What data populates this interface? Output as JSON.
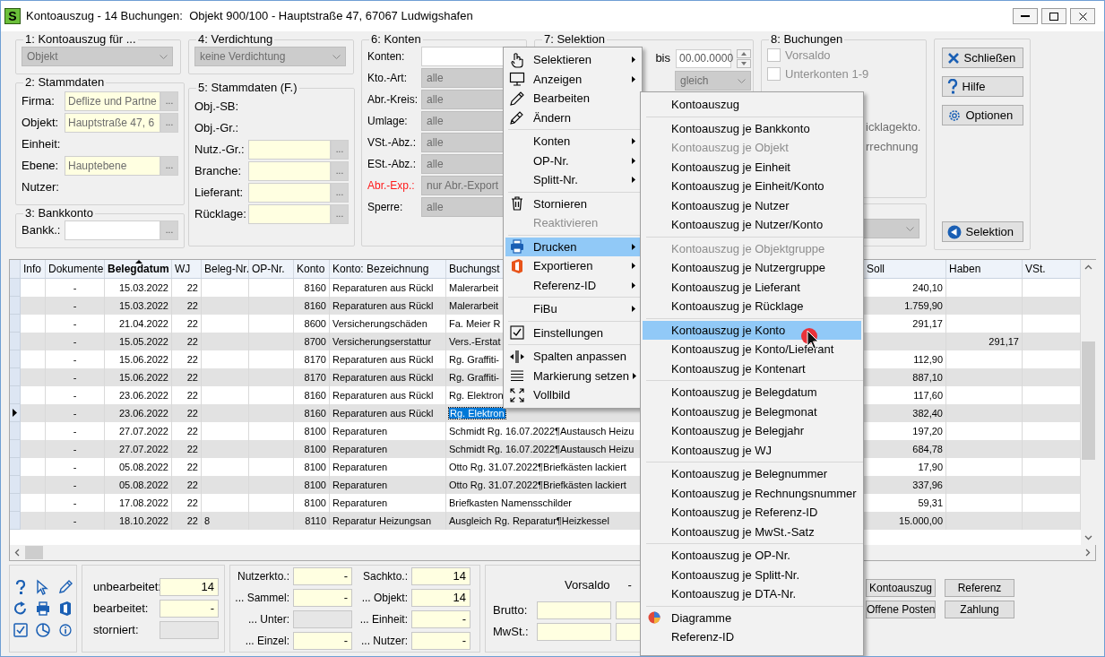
{
  "window": {
    "icon_letter": "S",
    "title": "Kontoauszug - 14 Buchungen:  Objekt 900/100 - Hauptstraße 47, 67067 Ludwigshafen"
  },
  "kontoauszug_fuer": {
    "title": "1: Kontoauszug für ...",
    "value": "Objekt"
  },
  "stammdaten": {
    "title": "2: Stammdaten",
    "rows": [
      {
        "label": "Firma:",
        "kind": "lookup",
        "value": "Deflize und Partne",
        "button": "..."
      },
      {
        "label": "Objekt:",
        "kind": "lookup",
        "value": "Hauptstraße 47, 6",
        "button": "..."
      },
      {
        "label": "Einheit:",
        "kind": "label"
      },
      {
        "label": "Ebene:",
        "kind": "lookup",
        "value": "Hauptebene",
        "button": "..."
      },
      {
        "label": "Nutzer:",
        "kind": "label"
      }
    ]
  },
  "bankkonto": {
    "title": "3: Bankkonto",
    "rows": [
      {
        "label": "Bankk.:",
        "kind": "input",
        "button": "..."
      }
    ]
  },
  "verdichtung": {
    "title": "4: Verdichtung",
    "value": "keine Verdichtung"
  },
  "stammdaten_f": {
    "title": "5: Stammdaten (F.)",
    "rows": [
      {
        "label": "Obj.-SB:",
        "kind": "label"
      },
      {
        "label": "Obj.-Gr.:",
        "kind": "label"
      },
      {
        "label": "Nutz.-Gr.:",
        "kind": "lookup",
        "button": "..."
      },
      {
        "label": "Branche:",
        "kind": "lookup",
        "button": "..."
      },
      {
        "label": "Lieferant:",
        "kind": "lookup",
        "button": "..."
      },
      {
        "label": "Rücklage:",
        "kind": "lookup",
        "button": "..."
      }
    ]
  },
  "konten": {
    "title": "6: Konten",
    "rows": [
      {
        "label": "Konten:",
        "kind": "input",
        "alert": false
      },
      {
        "label": "Kto.-Art:",
        "kind": "select",
        "value": "alle",
        "alert": false
      },
      {
        "label": "Abr.-Kreis:",
        "kind": "select",
        "value": "alle",
        "alert": false
      },
      {
        "label": "Umlage:",
        "kind": "select",
        "value": "alle",
        "alert": false
      },
      {
        "label": "VSt.-Abz.:",
        "kind": "select",
        "value": "alle",
        "alert": false
      },
      {
        "label": "ESt.-Abz.:",
        "kind": "select",
        "value": "alle",
        "alert": false
      },
      {
        "label": "Abr.-Exp.:",
        "kind": "select",
        "value": "nur Abr.-Export",
        "alert": true
      },
      {
        "label": "Sperre:",
        "kind": "select",
        "value": "alle",
        "alert": false
      }
    ]
  },
  "selektion": {
    "title": "7: Selektion",
    "to_label": "bis",
    "to_date": "00.00.0000",
    "mode": "gleich"
  },
  "buchungen": {
    "title": "8: Buchungen",
    "options": [
      {
        "label": "Vorsaldo",
        "checked": false,
        "disabled": true
      },
      {
        "label": "Unterkonten 1-9",
        "checked": false,
        "disabled": true
      }
    ],
    "partial_labels": [
      "icklagekto.",
      "rrechnung"
    ]
  },
  "actions": [
    {
      "label": "Schließen"
    },
    {
      "label": "Hilfe"
    },
    {
      "label": "Optionen"
    },
    {
      "label": "Selektion"
    }
  ],
  "table": {
    "columns": [
      {
        "label": "Info",
        "sorted": false
      },
      {
        "label": "Dokumente",
        "sorted": false
      },
      {
        "label": "Belegdatum",
        "sorted": true
      },
      {
        "label": "WJ",
        "sorted": false
      },
      {
        "label": "Beleg-Nr.",
        "sorted": false
      },
      {
        "label": "OP-Nr.",
        "sorted": false
      },
      {
        "label": "Konto",
        "sorted": false
      },
      {
        "label": "Konto: Bezeichnung",
        "sorted": false
      },
      {
        "label": "Buchungst",
        "sorted": false
      },
      {
        "label": "Soll",
        "sorted": false
      },
      {
        "label": "Haben",
        "sorted": false
      },
      {
        "label": "VSt.",
        "sorted": false
      }
    ],
    "rows": [
      {
        "selected": false,
        "dokumente": "-",
        "belegdatum": "15.03.2022",
        "wj": "22",
        "konto": "8160",
        "bezeichnung": "Reparaturen aus Rückl",
        "buchungstext": "Malerarbeit",
        "soll": "240,10"
      },
      {
        "selected": false,
        "dokumente": "-",
        "belegdatum": "15.03.2022",
        "wj": "22",
        "konto": "8160",
        "bezeichnung": "Reparaturen aus Rückl",
        "buchungstext": "Malerarbeit",
        "soll": "1.759,90"
      },
      {
        "selected": false,
        "dokumente": "-",
        "belegdatum": "21.04.2022",
        "wj": "22",
        "konto": "8600",
        "bezeichnung": "Versicherungschäden",
        "buchungstext": "Fa. Meier R",
        "soll": "291,17"
      },
      {
        "selected": false,
        "dokumente": "-",
        "belegdatum": "15.05.2022",
        "wj": "22",
        "konto": "8700",
        "bezeichnung": "Versicherungserstattur",
        "buchungstext": "Vers.-Erstat",
        "haben": "291,17"
      },
      {
        "selected": false,
        "dokumente": "-",
        "belegdatum": "15.06.2022",
        "wj": "22",
        "konto": "8170",
        "bezeichnung": "Reparaturen aus Rückl",
        "buchungstext": "Rg. Graffiti-",
        "soll": "112,90"
      },
      {
        "selected": false,
        "dokumente": "-",
        "belegdatum": "15.06.2022",
        "wj": "22",
        "konto": "8170",
        "bezeichnung": "Reparaturen aus Rückl",
        "buchungstext": "Rg. Graffiti-",
        "soll": "887,10"
      },
      {
        "selected": false,
        "dokumente": "-",
        "belegdatum": "23.06.2022",
        "wj": "22",
        "konto": "8160",
        "bezeichnung": "Reparaturen aus Rückl",
        "buchungstext": "Rg. Elektron",
        "soll": "117,60"
      },
      {
        "selected": true,
        "dokumente": "-",
        "belegdatum": "23.06.2022",
        "wj": "22",
        "konto": "8160",
        "bezeichnung": "Reparaturen aus Rückl",
        "buchungstext": "Rg. Elektron",
        "soll": "382,40"
      },
      {
        "selected": false,
        "dokumente": "-",
        "belegdatum": "27.07.2022",
        "wj": "22",
        "konto": "8100",
        "bezeichnung": "Reparaturen",
        "buchungstext": "Schmidt Rg. 16.07.2022¶Austausch Heizu",
        "soll": "197,20"
      },
      {
        "selected": false,
        "dokumente": "-",
        "belegdatum": "27.07.2022",
        "wj": "22",
        "konto": "8100",
        "bezeichnung": "Reparaturen",
        "buchungstext": "Schmidt Rg. 16.07.2022¶Austausch Heizu",
        "soll": "684,78"
      },
      {
        "selected": false,
        "dokumente": "-",
        "belegdatum": "05.08.2022",
        "wj": "22",
        "konto": "8100",
        "bezeichnung": "Reparaturen",
        "buchungstext": "Otto Rg. 31.07.2022¶Briefkästen lackiert",
        "soll": "17,90"
      },
      {
        "selected": false,
        "dokumente": "-",
        "belegdatum": "05.08.2022",
        "wj": "22",
        "konto": "8100",
        "bezeichnung": "Reparaturen",
        "buchungstext": "Otto Rg. 31.07.2022¶Briefkästen lackiert",
        "soll": "337,96"
      },
      {
        "selected": false,
        "dokumente": "-",
        "belegdatum": "17.08.2022",
        "wj": "22",
        "konto": "8100",
        "bezeichnung": "Reparaturen",
        "buchungstext": "Briefkasten Namensschilder",
        "soll": "59,31"
      },
      {
        "selected": false,
        "dokumente": "-",
        "belegdatum": "18.10.2022",
        "wj": "22",
        "beleg_nr": "8",
        "konto": "8110",
        "bezeichnung": "Reparatur Heizungsan",
        "buchungstext": "Ausgleich Rg. Reparatur¶Heizkessel",
        "soll": "15.000,00"
      }
    ]
  },
  "status_counts": [
    {
      "label": "unbearbeitet:",
      "value": "14",
      "disabled": false
    },
    {
      "label": "bearbeitet:",
      "value": "-",
      "disabled": false
    },
    {
      "label": "storniert:",
      "disabled": true
    }
  ],
  "nutzer_counts": [
    {
      "label": "Nutzerkto.:",
      "value": "-",
      "disabled": false
    },
    {
      "label": "... Sammel:",
      "value": "-",
      "disabled": false
    },
    {
      "label": "... Unter:",
      "disabled": true
    },
    {
      "label": "... Einzel:",
      "value": "-",
      "disabled": false
    }
  ],
  "sach_counts": [
    {
      "label": "Sachkto.:",
      "value": "14"
    },
    {
      "label": "... Objekt:",
      "value": "14"
    },
    {
      "label": "... Einheit:",
      "value": "-"
    },
    {
      "label": "... Nutzer:",
      "value": "-"
    }
  ],
  "saldo": {
    "heading": "Vorsaldo",
    "heading_value": "-",
    "rows": [
      {
        "label": "Brutto:"
      },
      {
        "label": "MwSt.:"
      }
    ]
  },
  "report_buttons": [
    "Kontoauszug",
    "Referenz",
    "Offene Posten",
    "Zahlung"
  ],
  "context_menu": {
    "groups": [
      [
        {
          "label": "Selektieren",
          "submenu": true,
          "disabled": false,
          "selected": false
        },
        {
          "label": "Anzeigen",
          "submenu": true,
          "disabled": false,
          "selected": false
        },
        {
          "label": "Bearbeiten",
          "submenu": false,
          "disabled": false,
          "selected": false
        },
        {
          "label": "Ändern",
          "submenu": false,
          "disabled": false,
          "selected": false
        }
      ],
      [
        {
          "label": "Konten",
          "submenu": true,
          "disabled": false,
          "selected": false
        },
        {
          "label": "OP-Nr.",
          "submenu": true,
          "disabled": false,
          "selected": false
        },
        {
          "label": "Splitt-Nr.",
          "submenu": true,
          "disabled": false,
          "selected": false
        }
      ],
      [
        {
          "label": "Stornieren",
          "submenu": false,
          "disabled": false,
          "selected": false
        },
        {
          "label": "Reaktivieren",
          "submenu": false,
          "disabled": true,
          "selected": false
        }
      ],
      [
        {
          "label": "Drucken",
          "submenu": true,
          "disabled": false,
          "selected": true
        },
        {
          "label": "Exportieren",
          "submenu": true,
          "disabled": false,
          "selected": false
        },
        {
          "label": "Referenz-ID",
          "submenu": true,
          "disabled": false,
          "selected": false
        }
      ],
      [
        {
          "label": "FiBu",
          "submenu": true,
          "disabled": false,
          "selected": false
        }
      ],
      [
        {
          "label": "Einstellungen",
          "submenu": false,
          "disabled": false,
          "selected": false
        }
      ],
      [
        {
          "label": "Spalten anpassen",
          "submenu": false,
          "disabled": false,
          "selected": false
        },
        {
          "label": "Markierung setzen",
          "submenu": true,
          "disabled": false,
          "selected": false
        },
        {
          "label": "Vollbild",
          "submenu": false,
          "disabled": false,
          "selected": false
        }
      ]
    ]
  },
  "print_submenu": {
    "groups": [
      [
        {
          "label": "Kontoauszug",
          "disabled": false,
          "selected": false
        }
      ],
      [
        {
          "label": "Kontoauszug je Bankkonto",
          "disabled": false,
          "selected": false
        },
        {
          "label": "Kontoauszug je Objekt",
          "disabled": true,
          "selected": false
        },
        {
          "label": "Kontoauszug je Einheit",
          "disabled": false,
          "selected": false
        },
        {
          "label": "Kontoauszug je Einheit/Konto",
          "disabled": false,
          "selected": false
        },
        {
          "label": "Kontoauszug je Nutzer",
          "disabled": false,
          "selected": false
        },
        {
          "label": "Kontoauszug je Nutzer/Konto",
          "disabled": false,
          "selected": false
        }
      ],
      [
        {
          "label": "Kontoauszug je Objektgruppe",
          "disabled": true,
          "selected": false
        },
        {
          "label": "Kontoauszug je Nutzergruppe",
          "disabled": false,
          "selected": false
        },
        {
          "label": "Kontoauszug je Lieferant",
          "disabled": false,
          "selected": false
        },
        {
          "label": "Kontoauszug je Rücklage",
          "disabled": false,
          "selected": false
        }
      ],
      [
        {
          "label": "Kontoauszug je Konto",
          "disabled": false,
          "selected": true
        },
        {
          "label": "Kontoauszug je Konto/Lieferant",
          "disabled": false,
          "selected": false
        },
        {
          "label": "Kontoauszug je Kontenart",
          "disabled": false,
          "selected": false
        }
      ],
      [
        {
          "label": "Kontoauszug je Belegdatum",
          "disabled": false,
          "selected": false
        },
        {
          "label": "Kontoauszug je Belegmonat",
          "disabled": false,
          "selected": false
        },
        {
          "label": "Kontoauszug je Belegjahr",
          "disabled": false,
          "selected": false
        },
        {
          "label": "Kontoauszug je WJ",
          "disabled": false,
          "selected": false
        }
      ],
      [
        {
          "label": "Kontoauszug je Belegnummer",
          "disabled": false,
          "selected": false
        },
        {
          "label": "Kontoauszug je Rechnungsnummer",
          "disabled": false,
          "selected": false
        },
        {
          "label": "Kontoauszug je Referenz-ID",
          "disabled": false,
          "selected": false
        },
        {
          "label": "Kontoauszug je MwSt.-Satz",
          "disabled": false,
          "selected": false
        }
      ],
      [
        {
          "label": "Kontoauszug je OP-Nr.",
          "disabled": false,
          "selected": false
        },
        {
          "label": "Kontoauszug je Splitt-Nr.",
          "disabled": false,
          "selected": false
        },
        {
          "label": "Kontoauszug je DTA-Nr.",
          "disabled": false,
          "selected": false
        }
      ],
      [
        {
          "label": "Diagramme",
          "disabled": false,
          "selected": false
        },
        {
          "label": "Referenz-ID",
          "disabled": false,
          "selected": false
        }
      ]
    ]
  }
}
